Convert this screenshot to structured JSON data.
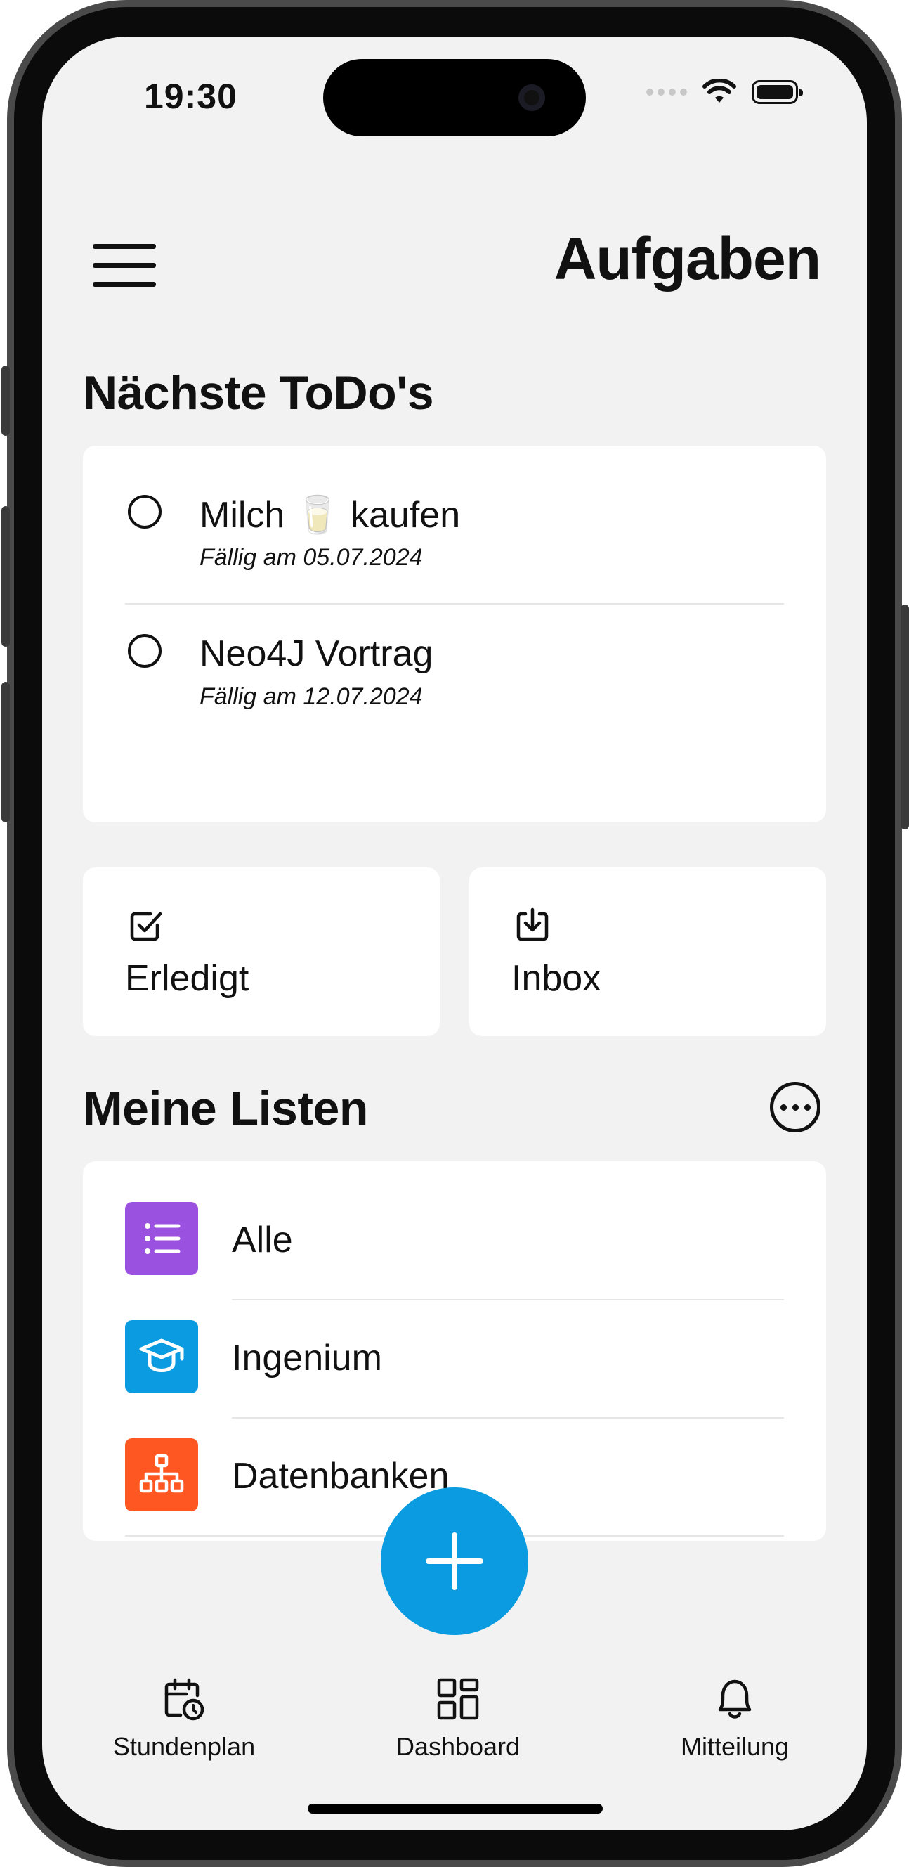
{
  "status_bar": {
    "time": "19:30"
  },
  "header": {
    "title": "Aufgaben"
  },
  "next_todos": {
    "title": "Nächste ToDo's",
    "items": [
      {
        "title": "Milch 🥛 kaufen",
        "due": "Fällig am 05.07.2024"
      },
      {
        "title": "Neo4J Vortrag",
        "due": "Fällig am 12.07.2024"
      }
    ]
  },
  "quick_cards": {
    "done": {
      "label": "Erledigt",
      "icon": "checkbox-icon"
    },
    "inbox": {
      "label": "Inbox",
      "icon": "inbox-download-icon"
    }
  },
  "my_lists": {
    "title": "Meine Listen",
    "items": [
      {
        "label": "Alle",
        "icon": "list-icon",
        "color": "#9b51e0"
      },
      {
        "label": "Ingenium",
        "icon": "graduation-cap-icon",
        "color": "#0a9be0"
      },
      {
        "label": "Datenbanken",
        "icon": "hierarchy-icon",
        "color": "#ff5722"
      }
    ]
  },
  "fab": {
    "icon": "plus-icon",
    "color": "#0a9be0"
  },
  "tab_bar": {
    "items": [
      {
        "label": "Stundenplan",
        "icon": "calendar-clock-icon"
      },
      {
        "label": "Dashboard",
        "icon": "dashboard-icon"
      },
      {
        "label": "Mitteilung",
        "icon": "bell-icon"
      }
    ]
  }
}
